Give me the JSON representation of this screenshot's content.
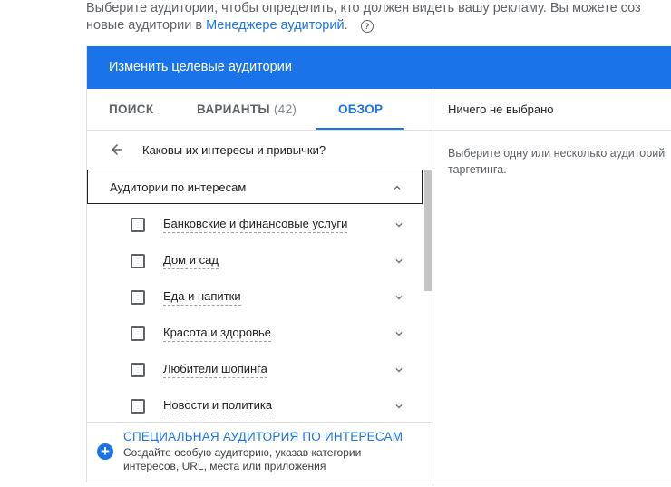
{
  "intro": {
    "line1": "Выберите аудитории, чтобы определить, кто должен видеть вашу рекламу.  Вы можете соз",
    "line2_prefix": "новые аудитории в ",
    "line2_link": "Менеджере аудиторий",
    "line2_suffix": ".",
    "help_glyph": "?"
  },
  "panel": {
    "title": "Изменить целевые аудитории",
    "tabs": [
      {
        "label": "ПОИСК"
      },
      {
        "label": "ВАРИАНТЫ",
        "count": "(42)"
      },
      {
        "label": "ОБЗОР"
      }
    ],
    "back_title": "Каковы их интересы и привычки?",
    "section_title": "Аудитории по интересам",
    "items": [
      {
        "label": "Банковские и финансовые услуги"
      },
      {
        "label": "Дом и сад"
      },
      {
        "label": "Еда и напитки"
      },
      {
        "label": "Красота и здоровье"
      },
      {
        "label": "Любители шопинга"
      },
      {
        "label": "Новости и политика"
      }
    ],
    "custom": {
      "title": "СПЕЦИАЛЬНАЯ АУДИТОРИЯ ПО ИНТЕРЕСАМ",
      "desc_line1": "Создайте особую аудиторию, указав категории",
      "desc_line2": "интересов, URL, места или приложения",
      "icon": "plus-circle-icon",
      "plus_glyph": "+"
    },
    "right": {
      "selected": "Ничего не выбрано",
      "empty_line1": "Выберите одну или несколько аудиторий",
      "empty_line2": "таргетинга."
    }
  },
  "colors": {
    "accent": "#1a73e8",
    "text": "#202124",
    "muted": "#5f6368"
  }
}
